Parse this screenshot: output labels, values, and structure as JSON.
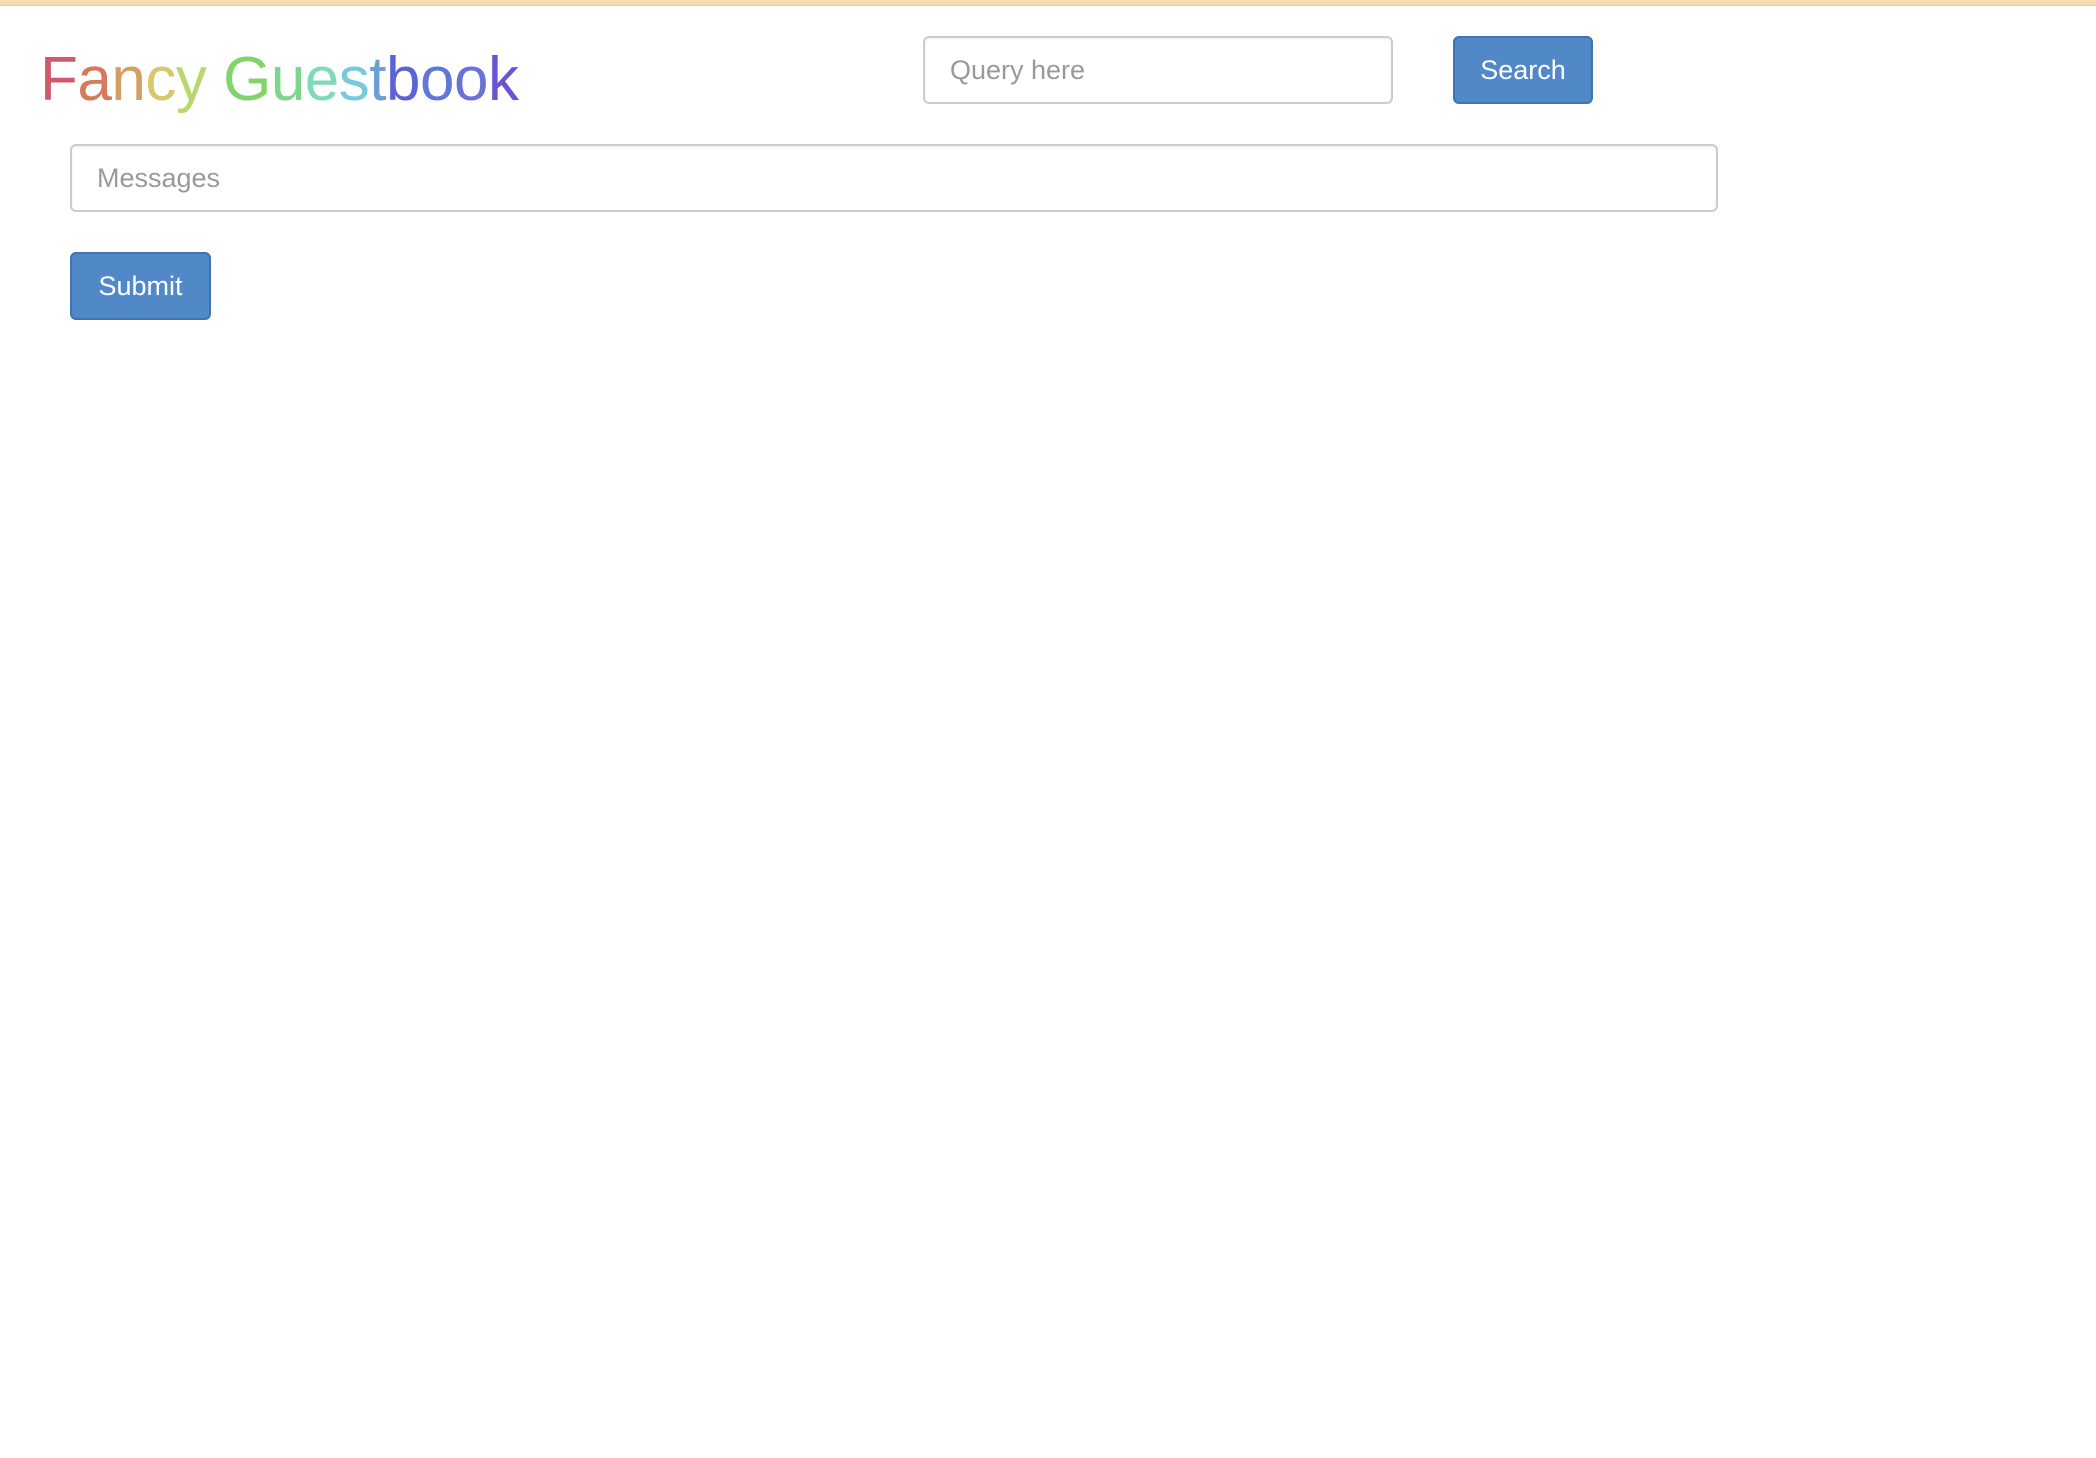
{
  "app": {
    "title_segments": [
      {
        "text": "F",
        "color": "#d0596b"
      },
      {
        "text": "a",
        "color": "#d57a5c"
      },
      {
        "text": "n",
        "color": "#d39f63"
      },
      {
        "text": "c",
        "color": "#d6c96c"
      },
      {
        "text": "y",
        "color": "#b8d86c"
      },
      {
        "text": " ",
        "color": "#ffffff"
      },
      {
        "text": "G",
        "color": "#83d36d"
      },
      {
        "text": "u",
        "color": "#7cd68c"
      },
      {
        "text": "e",
        "color": "#7fdbb6"
      },
      {
        "text": "s",
        "color": "#78c9dc"
      },
      {
        "text": "t",
        "color": "#6d9fd7"
      },
      {
        "text": "b",
        "color": "#5c63d8"
      },
      {
        "text": "o",
        "color": "#6076d9"
      },
      {
        "text": "o",
        "color": "#6a72d7"
      },
      {
        "text": "k",
        "color": "#6a54d4"
      }
    ]
  },
  "search": {
    "placeholder": "Query here",
    "value": "",
    "button_label": "Search"
  },
  "message_form": {
    "placeholder": "Messages",
    "value": "",
    "submit_label": "Submit"
  },
  "colors": {
    "button_bg": "#5189c8",
    "button_border": "#3f74b0",
    "top_strip": "#f7dcb0"
  }
}
